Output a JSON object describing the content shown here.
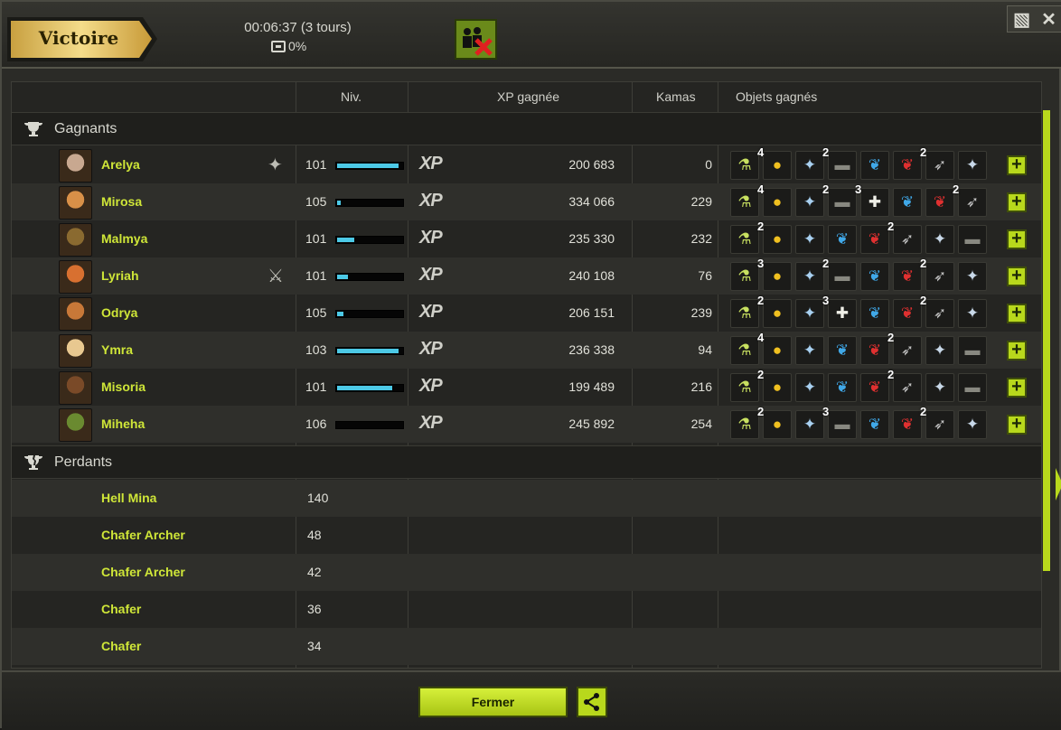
{
  "header": {
    "title": "Victoire",
    "timer": "00:06:37 (3 tours)",
    "chest": "0%"
  },
  "columns": {
    "level": "Niv.",
    "xp": "XP gagnée",
    "kamas": "Kamas",
    "items": "Objets gagnés"
  },
  "winners_label": "Gagnants",
  "losers_label": "Perdants",
  "xp_label": "XP",
  "close_label": "Fermer",
  "winners": [
    {
      "name": "Arelya",
      "level": "101",
      "progress": 0.94,
      "xp": "200 683",
      "kamas": "0",
      "icon": "person-icon",
      "avatar": "#c8a890",
      "items": [
        [
          "potion",
          ""
        ],
        [
          "kamas",
          "4"
        ],
        [
          "crystal",
          ""
        ],
        [
          "stone",
          "2"
        ],
        [
          "blue-wing",
          ""
        ],
        [
          "red-wing",
          ""
        ],
        [
          "feather",
          "2"
        ],
        [
          "crystal2",
          ""
        ]
      ]
    },
    {
      "name": "Mirosa",
      "level": "105",
      "progress": 0.05,
      "xp": "334 066",
      "kamas": "229",
      "icon": "",
      "avatar": "#d89048",
      "items": [
        [
          "potion",
          ""
        ],
        [
          "kamas",
          "4"
        ],
        [
          "crystal",
          ""
        ],
        [
          "stone",
          "2"
        ],
        [
          "bone",
          "3"
        ],
        [
          "blue-wing",
          ""
        ],
        [
          "red-wing",
          ""
        ],
        [
          "feather",
          "2"
        ]
      ]
    },
    {
      "name": "Malmya",
      "level": "101",
      "progress": 0.26,
      "xp": "235 330",
      "kamas": "232",
      "icon": "",
      "avatar": "#8a6a30",
      "items": [
        [
          "potion",
          ""
        ],
        [
          "kamas",
          "2"
        ],
        [
          "crystal",
          ""
        ],
        [
          "blue-wing",
          ""
        ],
        [
          "red-wing",
          ""
        ],
        [
          "feather",
          "2"
        ],
        [
          "crystal2",
          ""
        ],
        [
          "stone",
          ""
        ]
      ]
    },
    {
      "name": "Lyriah",
      "level": "101",
      "progress": 0.16,
      "xp": "240 108",
      "kamas": "76",
      "icon": "sword-icon",
      "avatar": "#d87030",
      "items": [
        [
          "potion",
          ""
        ],
        [
          "kamas",
          "3"
        ],
        [
          "crystal",
          ""
        ],
        [
          "stone",
          "2"
        ],
        [
          "blue-wing",
          ""
        ],
        [
          "red-wing",
          ""
        ],
        [
          "feather",
          "2"
        ],
        [
          "crystal2",
          ""
        ]
      ]
    },
    {
      "name": "Odrya",
      "level": "105",
      "progress": 0.1,
      "xp": "206 151",
      "kamas": "239",
      "icon": "",
      "avatar": "#c87838",
      "items": [
        [
          "potion",
          ""
        ],
        [
          "kamas",
          "2"
        ],
        [
          "crystal",
          ""
        ],
        [
          "bone",
          "3"
        ],
        [
          "blue-wing",
          ""
        ],
        [
          "red-wing",
          ""
        ],
        [
          "feather",
          "2"
        ],
        [
          "crystal2",
          ""
        ]
      ]
    },
    {
      "name": "Ymra",
      "level": "103",
      "progress": 0.94,
      "xp": "236 338",
      "kamas": "94",
      "icon": "",
      "avatar": "#e8c890",
      "items": [
        [
          "potion",
          ""
        ],
        [
          "kamas",
          "4"
        ],
        [
          "crystal",
          ""
        ],
        [
          "blue-wing",
          ""
        ],
        [
          "red-wing",
          ""
        ],
        [
          "feather",
          "2"
        ],
        [
          "crystal2",
          ""
        ],
        [
          "stone",
          ""
        ]
      ]
    },
    {
      "name": "Misoria",
      "level": "101",
      "progress": 0.85,
      "xp": "199 489",
      "kamas": "216",
      "icon": "",
      "avatar": "#7a4a28",
      "items": [
        [
          "potion",
          ""
        ],
        [
          "kamas",
          "2"
        ],
        [
          "crystal",
          ""
        ],
        [
          "blue-wing",
          ""
        ],
        [
          "red-wing",
          ""
        ],
        [
          "feather",
          "2"
        ],
        [
          "crystal2",
          ""
        ],
        [
          "stone",
          ""
        ]
      ]
    },
    {
      "name": "Miheha",
      "level": "106",
      "progress": 0.0,
      "xp": "245 892",
      "kamas": "254",
      "icon": "",
      "avatar": "#6a8a30",
      "items": [
        [
          "potion",
          ""
        ],
        [
          "kamas",
          "2"
        ],
        [
          "crystal",
          ""
        ],
        [
          "stone",
          "3"
        ],
        [
          "blue-wing",
          ""
        ],
        [
          "red-wing",
          ""
        ],
        [
          "feather",
          "2"
        ],
        [
          "crystal2",
          ""
        ]
      ]
    }
  ],
  "losers": [
    {
      "name": "Hell Mina",
      "level": "140"
    },
    {
      "name": "Chafer Archer",
      "level": "48"
    },
    {
      "name": "Chafer Archer",
      "level": "42"
    },
    {
      "name": "Chafer",
      "level": "36"
    },
    {
      "name": "Chafer",
      "level": "34"
    }
  ]
}
